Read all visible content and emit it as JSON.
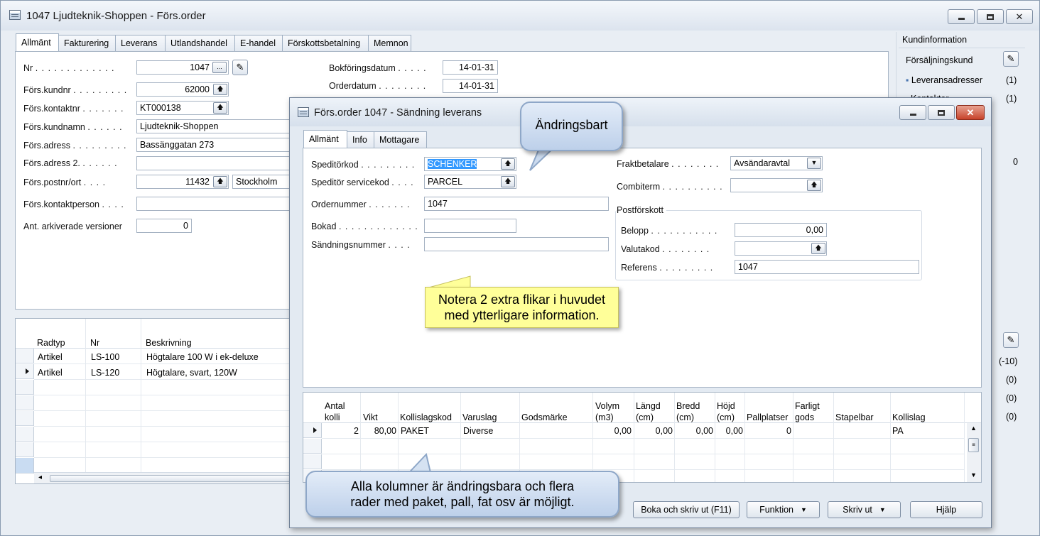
{
  "main": {
    "title": "1047 Ljudteknik-Shoppen - Förs.order",
    "tabs": [
      "Allmänt",
      "Fakturering",
      "Leverans",
      "Utlandshandel",
      "E-handel",
      "Förskottsbetalning",
      "Memnon"
    ],
    "fields": {
      "nr_label": "Nr",
      "nr": "1047",
      "kundnr_label": "Förs.kundnr",
      "kundnr": "62000",
      "kontaktnr_label": "Förs.kontaktnr",
      "kontaktnr": "KT000138",
      "kundnamn_label": "Förs.kundnamn",
      "kundnamn": "Ljudteknik-Shoppen",
      "adress_label": "Förs.adress",
      "adress": "Bassänggatan 273",
      "adress2_label": "Förs.adress 2.",
      "adress2": "",
      "postnr_label": "Förs.postnr/ort",
      "postnr": "11432",
      "ort": "Stockholm",
      "kontaktperson_label": "Förs.kontaktperson",
      "kontaktperson": "",
      "arkiverade_label": "Ant. arkiverade versioner",
      "arkiverade": "0",
      "bokforingsdatum_label": "Bokföringsdatum",
      "bokforingsdatum": "14-01-31",
      "orderdatum_label": "Orderdatum",
      "orderdatum": "14-01-31"
    },
    "lines": {
      "headers": [
        "Radtyp",
        "Nr",
        "Beskrivning"
      ],
      "rows": [
        [
          "Artikel",
          "LS-100",
          "Högtalare 100 W i ek-deluxe"
        ],
        [
          "Artikel",
          "LS-120",
          "Högtalare, svart, 120W"
        ]
      ]
    },
    "sidebar": {
      "title": "Kundinformation",
      "items": [
        {
          "label": "Försäljningskund",
          "value": ""
        },
        {
          "label": "Leveransadresser",
          "value": "(1)"
        },
        {
          "label": "Kontakter",
          "value": "(1)"
        }
      ],
      "extra_value": "0",
      "lower_values": [
        "(-10)",
        "(0)",
        "(0)",
        "(0)"
      ]
    }
  },
  "dialog": {
    "title": "Förs.order 1047 - Sändning leverans",
    "tabs": [
      "Allmänt",
      "Info",
      "Mottagare"
    ],
    "fields": {
      "speditorkod_label": "Speditörkod",
      "speditorkod": "SCHENKER",
      "servicekod_label": "Speditör servicekod",
      "servicekod": "PARCEL",
      "ordernummer_label": "Ordernummer",
      "ordernummer": "1047",
      "bokad_label": "Bokad",
      "bokad": "",
      "sandningsnummer_label": "Sändningsnummer",
      "sandningsnummer": "",
      "fraktbetalare_label": "Fraktbetalare",
      "fraktbetalare": "Avsändaravtal",
      "combiterm_label": "Combiterm",
      "combiterm": "",
      "postforskott_title": "Postförskott",
      "belopp_label": "Belopp",
      "belopp": "0,00",
      "valutakod_label": "Valutakod",
      "valutakod": "",
      "referens_label": "Referens",
      "referens": "1047"
    },
    "grid": {
      "headers": [
        [
          "Antal",
          "kolli"
        ],
        [
          "",
          "Vikt"
        ],
        [
          "",
          "Kollislagskod"
        ],
        [
          "",
          "Varuslag"
        ],
        [
          "",
          "Godsmärke"
        ],
        [
          "Volym",
          "(m3)"
        ],
        [
          "Längd",
          "(cm)"
        ],
        [
          "Bredd",
          "(cm)"
        ],
        [
          "Höjd",
          "(cm)"
        ],
        [
          "",
          "Pallplatser"
        ],
        [
          "Farligt",
          "gods"
        ],
        [
          "",
          "Stapelbar"
        ],
        [
          "",
          "Kollislag"
        ]
      ],
      "row": [
        "2",
        "80,00",
        "PAKET",
        "Diverse",
        "",
        "0,00",
        "0,00",
        "0,00",
        "0,00",
        "0",
        "",
        "",
        "PA"
      ]
    },
    "buttons": {
      "boka": "Boka och skriv ut (F11)",
      "funktion": "Funktion",
      "skriv_ut": "Skriv ut",
      "hjalp": "Hjälp"
    }
  },
  "callouts": {
    "andringsbart": "Ändringsbart",
    "notera_1": "Notera 2 extra flikar i huvudet",
    "notera_2": "med ytterligare information.",
    "kolumner_1": "Alla kolumner är ändringsbara och flera",
    "kolumner_2": "rader med paket, pall, fat osv är möjligt."
  }
}
